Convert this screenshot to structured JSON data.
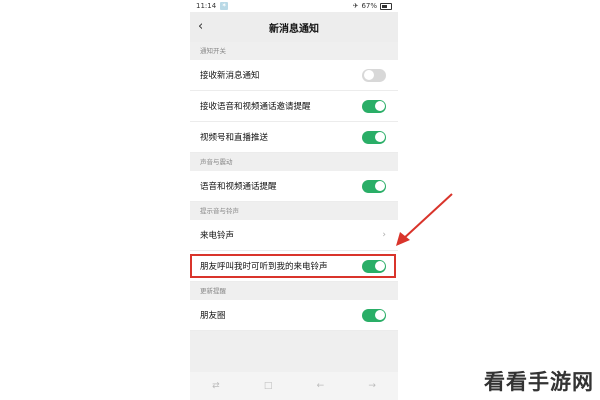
{
  "status_bar": {
    "time": "11:14",
    "notification_badge": "✶",
    "battery_text": "67%"
  },
  "header": {
    "back_glyph": "‹",
    "title": "新消息通知"
  },
  "sections": [
    {
      "label": "通知开关",
      "rows": [
        {
          "label": "接收新消息通知",
          "control": "toggle",
          "on": false
        },
        {
          "label": "接收语音和视频通话邀请提醒",
          "control": "toggle",
          "on": true
        },
        {
          "label": "视频号和直播推送",
          "control": "toggle",
          "on": true
        }
      ]
    },
    {
      "label": "声音与震动",
      "rows": [
        {
          "label": "语音和视频通话提醒",
          "control": "toggle",
          "on": true
        }
      ]
    },
    {
      "label": "提示音与铃声",
      "rows": [
        {
          "label": "来电铃声",
          "control": "chevron",
          "glyph": "›"
        },
        {
          "label": "朋友呼叫我时可听到我的来电铃声",
          "control": "toggle",
          "on": true
        }
      ]
    },
    {
      "label": "更新提醒",
      "rows": [
        {
          "label": "朋友圈",
          "control": "toggle",
          "on": true
        }
      ]
    }
  ],
  "soft_keys": [
    "⇄",
    "□",
    "←",
    "→"
  ],
  "watermark": "看看手游网",
  "colors": {
    "accent_green": "#2aae67",
    "highlight_red": "#d9342b",
    "toggle_off": "#d8d8d8"
  }
}
